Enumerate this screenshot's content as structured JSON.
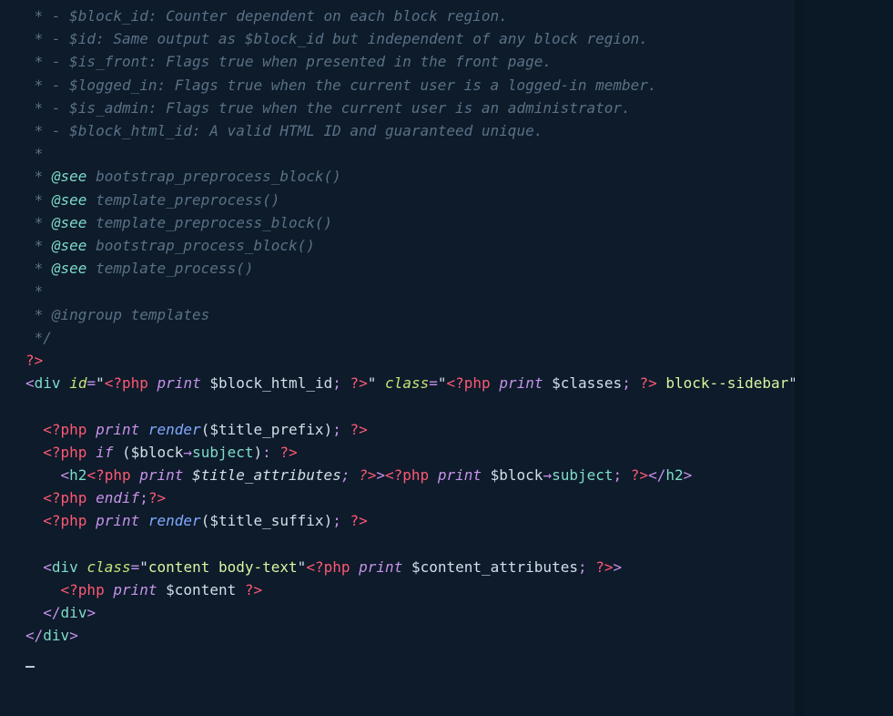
{
  "lines": {
    "c1": " * - $block_id: Counter dependent on each block region.",
    "c2": " * - $id: Same output as $block_id but independent of any block region.",
    "c3": " * - $is_front: Flags true when presented in the front page.",
    "c4": " * - $logged_in: Flags true when the current user is a logged-in member.",
    "c5": " * - $is_admin: Flags true when the current user is an administrator.",
    "c6": " * - $block_html_id: A valid HTML ID and guaranteed unique.",
    "c7": " *",
    "see_pre": " * ",
    "see_tag": "@see",
    "see1": " bootstrap_preprocess_block()",
    "see2": " template_preprocess()",
    "see3": " template_preprocess_block()",
    "see4": " bootstrap_process_block()",
    "see5": " template_process()",
    "c8": " * @ingroup templates",
    "c9": " */",
    "phpclose": "?>",
    "div_open_a": "<",
    "div_tag": "div",
    "sp": " ",
    "attr_id": "id",
    "eq": "=",
    "quote": "\"",
    "phpopen": "<?php",
    "print": "print",
    "if": "if",
    "endif": "endif",
    "render": "render",
    "var_block_html_id": "$block_html_id",
    "var_classes": "$classes",
    "var_title_prefix": "$title_prefix",
    "var_title_suffix": "$title_suffix",
    "var_title_attributes": "$title_attributes",
    "var_block": "$block",
    "var_content_attributes": "$content_attributes",
    "var_content": "$content",
    "phpend": "?>",
    "attr_class": "class",
    "block_sidebar": " block--sidebar",
    "lt": "<",
    "gt": ">",
    "slash": "/",
    "h2": "h2",
    "arrow": "→",
    "subject": "subject",
    "content_body": "content body-text",
    "semi": ";",
    "colon": ":",
    "lp": "(",
    "rp": ")",
    "pipe": " ",
    "indent2": "  ",
    "indent4": "    ",
    "divclose": "div"
  }
}
